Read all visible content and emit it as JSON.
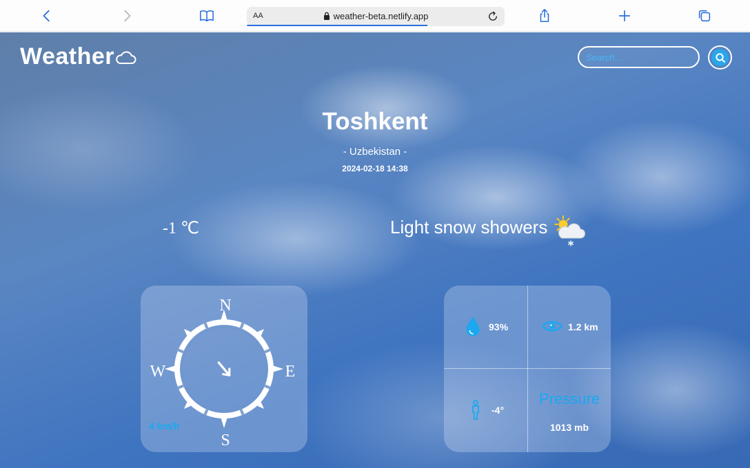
{
  "browser": {
    "text_size_label": "AA",
    "url": "weather-beta.netlify.app"
  },
  "header": {
    "logo_text": "Weather",
    "search_placeholder": "Search..."
  },
  "location": {
    "city": "Toshkent",
    "country": "- Uzbekistan -",
    "datetime": "2024-02-18 14:38"
  },
  "current": {
    "temperature": "-1 ℃",
    "condition": "Light snow showers"
  },
  "compass": {
    "north": "N",
    "south": "S",
    "east": "E",
    "west": "W",
    "wind_speed": "4 km/h"
  },
  "stats": {
    "humidity": "93%",
    "visibility": "1.2 km",
    "feels_like": "-4°",
    "pressure_label": "Pressure",
    "pressure_value": "1013 mb"
  },
  "colors": {
    "accent": "#1aa8f0",
    "browser_blue": "#2a6fe0"
  }
}
